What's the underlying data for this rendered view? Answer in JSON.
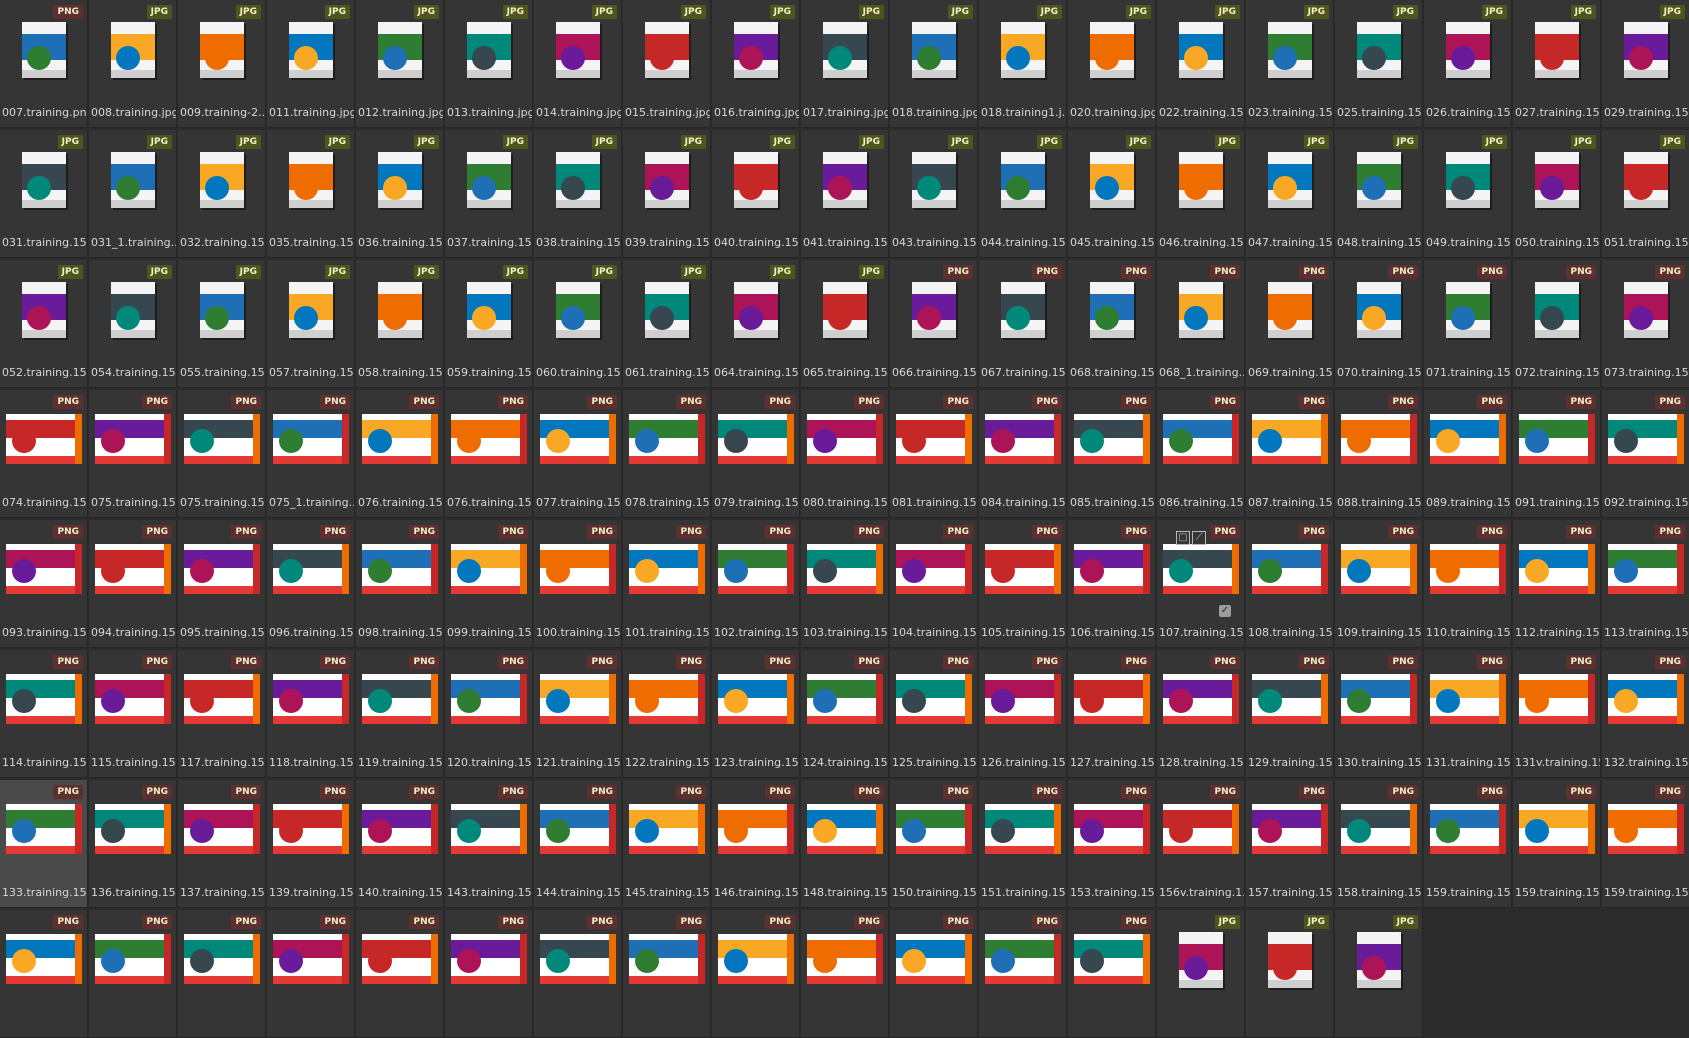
{
  "browser": {
    "files": [
      {
        "name": "007.training.png",
        "ext": "PNG"
      },
      {
        "name": "008.training.jpg",
        "ext": "JPG"
      },
      {
        "name": "009.training-2...",
        "ext": "JPG"
      },
      {
        "name": "011.training.jpg",
        "ext": "JPG"
      },
      {
        "name": "012.training.jpg",
        "ext": "JPG"
      },
      {
        "name": "013.training.jpg",
        "ext": "JPG"
      },
      {
        "name": "014.training.jpg",
        "ext": "JPG"
      },
      {
        "name": "015.training.jpg",
        "ext": "JPG"
      },
      {
        "name": "016.training.jpg",
        "ext": "JPG"
      },
      {
        "name": "017.training.jpg",
        "ext": "JPG"
      },
      {
        "name": "018.training.jpg",
        "ext": "JPG"
      },
      {
        "name": "018.training1.j...",
        "ext": "JPG"
      },
      {
        "name": "020.training.jpg",
        "ext": "JPG"
      },
      {
        "name": "022.training.15...",
        "ext": "JPG"
      },
      {
        "name": "023.training.15...",
        "ext": "JPG"
      },
      {
        "name": "025.training.15...",
        "ext": "JPG"
      },
      {
        "name": "026.training.15...",
        "ext": "JPG"
      },
      {
        "name": "027.training.15...",
        "ext": "JPG"
      },
      {
        "name": "029.training.15...",
        "ext": "JPG"
      },
      {
        "name": "031.training.15...",
        "ext": "JPG"
      },
      {
        "name": "031_1.training....",
        "ext": "JPG"
      },
      {
        "name": "032.training.15...",
        "ext": "JPG"
      },
      {
        "name": "035.training.15...",
        "ext": "JPG"
      },
      {
        "name": "036.training.15...",
        "ext": "JPG"
      },
      {
        "name": "037.training.15...",
        "ext": "JPG"
      },
      {
        "name": "038.training.15...",
        "ext": "JPG"
      },
      {
        "name": "039.training.15...",
        "ext": "JPG"
      },
      {
        "name": "040.training.15...",
        "ext": "JPG"
      },
      {
        "name": "041.training.15...",
        "ext": "JPG"
      },
      {
        "name": "043.training.15...",
        "ext": "JPG"
      },
      {
        "name": "044.training.15...",
        "ext": "JPG"
      },
      {
        "name": "045.training.15...",
        "ext": "JPG"
      },
      {
        "name": "046.training.15...",
        "ext": "JPG"
      },
      {
        "name": "047.training.15...",
        "ext": "JPG"
      },
      {
        "name": "048.training.15...",
        "ext": "JPG"
      },
      {
        "name": "049.training.15...",
        "ext": "JPG"
      },
      {
        "name": "050.training.15...",
        "ext": "JPG"
      },
      {
        "name": "051.training.15...",
        "ext": "JPG"
      },
      {
        "name": "052.training.15...",
        "ext": "JPG"
      },
      {
        "name": "054.training.15...",
        "ext": "JPG"
      },
      {
        "name": "055.training.15...",
        "ext": "JPG"
      },
      {
        "name": "057.training.15...",
        "ext": "JPG"
      },
      {
        "name": "058.training.15...",
        "ext": "JPG"
      },
      {
        "name": "059.training.15...",
        "ext": "JPG"
      },
      {
        "name": "060.training.15...",
        "ext": "JPG"
      },
      {
        "name": "061.training.15...",
        "ext": "JPG"
      },
      {
        "name": "064.training.15...",
        "ext": "JPG"
      },
      {
        "name": "065.training.15...",
        "ext": "JPG"
      },
      {
        "name": "066.training.15...",
        "ext": "PNG"
      },
      {
        "name": "067.training.15...",
        "ext": "PNG"
      },
      {
        "name": "068.training.15...",
        "ext": "PNG"
      },
      {
        "name": "068_1.training....",
        "ext": "PNG"
      },
      {
        "name": "069.training.15...",
        "ext": "PNG"
      },
      {
        "name": "070.training.15...",
        "ext": "PNG"
      },
      {
        "name": "071.training.15...",
        "ext": "PNG"
      },
      {
        "name": "072.training.15...",
        "ext": "PNG"
      },
      {
        "name": "073.training.15...",
        "ext": "PNG"
      },
      {
        "name": "074.training.15...",
        "ext": "PNG"
      },
      {
        "name": "075.training.15...",
        "ext": "PNG"
      },
      {
        "name": "075.training.15...",
        "ext": "PNG"
      },
      {
        "name": "075_1.training....",
        "ext": "PNG"
      },
      {
        "name": "076.training.15...",
        "ext": "PNG"
      },
      {
        "name": "076.training.15...",
        "ext": "PNG"
      },
      {
        "name": "077.training.15...",
        "ext": "PNG"
      },
      {
        "name": "078.training.15...",
        "ext": "PNG"
      },
      {
        "name": "079.training.15...",
        "ext": "PNG"
      },
      {
        "name": "080.training.15...",
        "ext": "PNG"
      },
      {
        "name": "081.training.15...",
        "ext": "PNG"
      },
      {
        "name": "084.training.15...",
        "ext": "PNG"
      },
      {
        "name": "085.training.15...",
        "ext": "PNG"
      },
      {
        "name": "086.training.15...",
        "ext": "PNG"
      },
      {
        "name": "087.training.15...",
        "ext": "PNG"
      },
      {
        "name": "088.training.15...",
        "ext": "PNG"
      },
      {
        "name": "089.training.15...",
        "ext": "PNG"
      },
      {
        "name": "091.training.15...",
        "ext": "PNG"
      },
      {
        "name": "092.training.15...",
        "ext": "PNG"
      },
      {
        "name": "093.training.15...",
        "ext": "PNG"
      },
      {
        "name": "094.training.15...",
        "ext": "PNG"
      },
      {
        "name": "095.training.15...",
        "ext": "PNG"
      },
      {
        "name": "096.training.15...",
        "ext": "PNG"
      },
      {
        "name": "098.training.15...",
        "ext": "PNG"
      },
      {
        "name": "099.training.15...",
        "ext": "PNG"
      },
      {
        "name": "100.training.15...",
        "ext": "PNG"
      },
      {
        "name": "101.training.15...",
        "ext": "PNG"
      },
      {
        "name": "102.training.15...",
        "ext": "PNG"
      },
      {
        "name": "103.training.15...",
        "ext": "PNG"
      },
      {
        "name": "104.training.15...",
        "ext": "PNG"
      },
      {
        "name": "105.training.15...",
        "ext": "PNG"
      },
      {
        "name": "106.training.15...",
        "ext": "PNG"
      },
      {
        "name": "107.training.15...",
        "ext": "PNG"
      },
      {
        "name": "108.training.15...",
        "ext": "PNG"
      },
      {
        "name": "109.training.15...",
        "ext": "PNG"
      },
      {
        "name": "110.training.15...",
        "ext": "PNG"
      },
      {
        "name": "112.training.15...",
        "ext": "PNG"
      },
      {
        "name": "113.training.15...",
        "ext": "PNG"
      },
      {
        "name": "114.training.15...",
        "ext": "PNG"
      },
      {
        "name": "115.training.15...",
        "ext": "PNG"
      },
      {
        "name": "117.training.15...",
        "ext": "PNG"
      },
      {
        "name": "118.training.15...",
        "ext": "PNG"
      },
      {
        "name": "119.training.15...",
        "ext": "PNG"
      },
      {
        "name": "120.training.15...",
        "ext": "PNG"
      },
      {
        "name": "121.training.15...",
        "ext": "PNG"
      },
      {
        "name": "122.training.15...",
        "ext": "PNG"
      },
      {
        "name": "123.training.15...",
        "ext": "PNG"
      },
      {
        "name": "124.training.15...",
        "ext": "PNG"
      },
      {
        "name": "125.training.15...",
        "ext": "PNG"
      },
      {
        "name": "126.training.15...",
        "ext": "PNG"
      },
      {
        "name": "127.training.15...",
        "ext": "PNG"
      },
      {
        "name": "128.training.15...",
        "ext": "PNG"
      },
      {
        "name": "129.training.15...",
        "ext": "PNG"
      },
      {
        "name": "130.training.15...",
        "ext": "PNG"
      },
      {
        "name": "131.training.15...",
        "ext": "PNG"
      },
      {
        "name": "131v.training.15...",
        "ext": "PNG"
      },
      {
        "name": "132.training.15...",
        "ext": "PNG"
      },
      {
        "name": "133.training.15...",
        "ext": "PNG"
      },
      {
        "name": "136.training.15...",
        "ext": "PNG"
      },
      {
        "name": "137.training.15...",
        "ext": "PNG"
      },
      {
        "name": "139.training.15...",
        "ext": "PNG"
      },
      {
        "name": "140.training.15...",
        "ext": "PNG"
      },
      {
        "name": "143.training.15...",
        "ext": "PNG"
      },
      {
        "name": "144.training.15...",
        "ext": "PNG"
      },
      {
        "name": "145.training.15...",
        "ext": "PNG"
      },
      {
        "name": "146.training.15...",
        "ext": "PNG"
      },
      {
        "name": "148.training.15...",
        "ext": "PNG"
      },
      {
        "name": "150.training.15...",
        "ext": "PNG"
      },
      {
        "name": "151.training.15...",
        "ext": "PNG"
      },
      {
        "name": "153.training.15...",
        "ext": "PNG"
      },
      {
        "name": "156v.training.1...",
        "ext": "PNG"
      },
      {
        "name": "157.training.15...",
        "ext": "PNG"
      },
      {
        "name": "158.training.15...",
        "ext": "PNG"
      },
      {
        "name": "159.training.15...",
        "ext": "PNG"
      },
      {
        "name": "159.training.15...",
        "ext": "PNG"
      },
      {
        "name": "159.training.15...",
        "ext": "PNG"
      },
      {
        "name": "",
        "ext": "PNG"
      },
      {
        "name": "",
        "ext": "PNG"
      },
      {
        "name": "",
        "ext": "PNG"
      },
      {
        "name": "",
        "ext": "PNG"
      },
      {
        "name": "",
        "ext": "PNG"
      },
      {
        "name": "",
        "ext": "PNG"
      },
      {
        "name": "",
        "ext": "PNG"
      },
      {
        "name": "",
        "ext": "PNG"
      },
      {
        "name": "",
        "ext": "PNG"
      },
      {
        "name": "",
        "ext": "PNG"
      },
      {
        "name": "",
        "ext": "PNG"
      },
      {
        "name": "",
        "ext": "PNG"
      },
      {
        "name": "",
        "ext": "PNG"
      },
      {
        "name": "",
        "ext": "JPG"
      },
      {
        "name": "",
        "ext": "JPG"
      },
      {
        "name": "",
        "ext": "JPG"
      }
    ],
    "selected_index": 114,
    "hovered_index": 89,
    "hover_check_glyph": "✓",
    "hover_tools": [
      "▢",
      "⟋"
    ],
    "colors": {
      "background": "#2b2b2b",
      "tile": "#353535",
      "tile_selected": "#4a4a4a",
      "png_badge": "#5d2f2f",
      "jpg_badge": "#4e561d",
      "label": "#d7d7d7"
    },
    "thumb_palette": [
      "#1e6fb5",
      "#c62828",
      "#2e7d32",
      "#f9a825",
      "#6a1b9a",
      "#00897b",
      "#ef6c00",
      "#37474f",
      "#ad1457",
      "#0277bd"
    ]
  }
}
